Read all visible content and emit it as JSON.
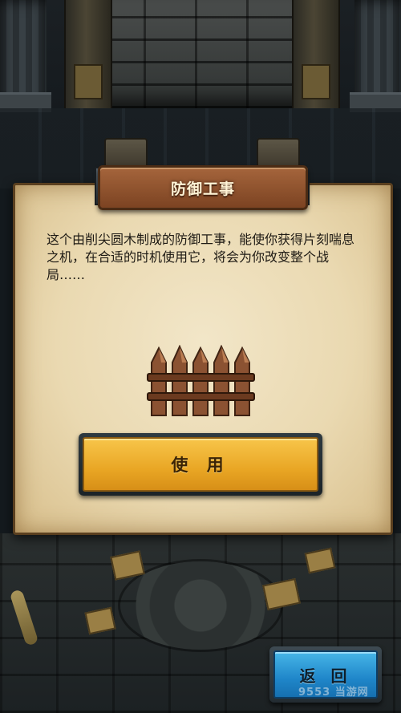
{
  "dialog": {
    "title": "防御工事",
    "description": "这个由削尖圆木制成的防御工事，能使你获得片刻喘息之机，在合适的时机使用它，将会为你改变整个战局……",
    "item_icon": "wooden-barricade-icon",
    "use_label": "使 用"
  },
  "footer": {
    "back_label": "返 回"
  },
  "watermark": {
    "text": "9553 当游网"
  },
  "colors": {
    "parchment": "#ead9b1",
    "title_banner": "#8d5029",
    "use_button": "#f0b232",
    "back_button": "#2a96d6",
    "background": "#141a1e"
  }
}
